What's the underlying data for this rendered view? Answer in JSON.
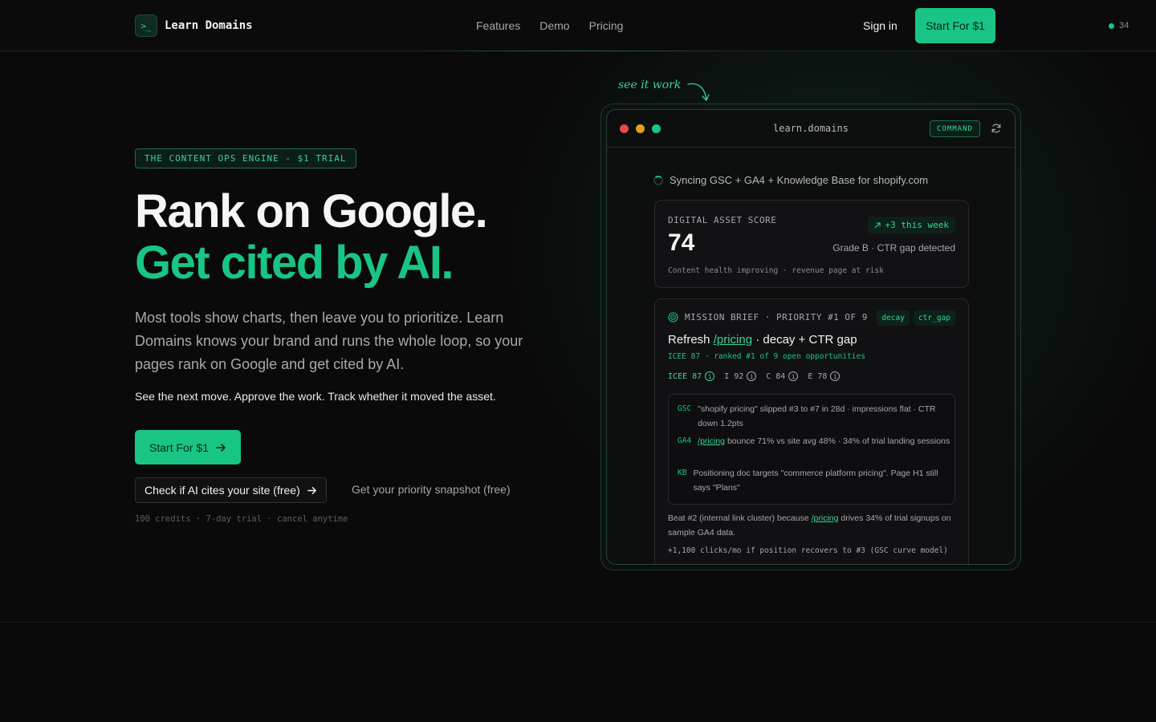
{
  "nav": {
    "logo_glyph": ">_",
    "brand": "Learn Domains",
    "links": [
      "Features",
      "Demo",
      "Pricing"
    ],
    "signin": "Sign in",
    "cta": "Start For $1",
    "online_count": "34",
    "accent": "#19c585"
  },
  "hero": {
    "badge": "THE CONTENT OPS ENGINE - $1 TRIAL",
    "title_line1": "Rank on Google.",
    "title_line2": "Get cited by AI.",
    "lead": "Most tools show charts, then leave you to prioritize. Learn Domains knows your brand and runs the whole loop, so your pages rank on Google and get cited by AI.",
    "sub": "See the next move. Approve the work. Track whether it moved the asset.",
    "cta_main": "Start For $1",
    "cta_secondary": "Check if AI cites your site (free)",
    "cta_link": "Get your priority snapshot (free)",
    "fine_print": "100 credits · 7-day trial · cancel anytime"
  },
  "demo": {
    "annotation": "see it work",
    "url": "learn.domains",
    "mode_badge": "COMMAND",
    "sync_text": "Syncing GSC + GA4 + Knowledge Base for shopify.com",
    "score_card": {
      "label": "DIGITAL ASSET SCORE",
      "score": "74",
      "delta": "+3 this week",
      "grade": "Grade B · CTR gap detected",
      "footer": "Content health improving · revenue page at risk"
    },
    "mission": {
      "header": "MISSION BRIEF · PRIORITY #1 OF 9",
      "tags": [
        "decay",
        "ctr_gap"
      ],
      "title_prefix": "Refresh",
      "title_link": "/pricing",
      "title_suffix": "· decay + CTR gap",
      "subtitle": "ICEE 87 · ranked #1 of 9 open opportunities",
      "scores": [
        {
          "label": "ICEE 87"
        },
        {
          "label": "I 92"
        },
        {
          "label": "C 84"
        },
        {
          "label": "E 78"
        }
      ],
      "evidence": [
        {
          "src": "GSC",
          "text": "\"shopify pricing\" slipped #3 to #7 in 28d · impressions flat · CTR down 1.2pts"
        },
        {
          "src": "GA4",
          "link": "/pricing",
          "text": "bounce 71% vs site avg 48% · 34% of trial landing sessions"
        },
        {
          "src": "KB",
          "text": "Positioning doc targets \"commerce platform pricing\". Page H1 still says \"Plans\""
        }
      ],
      "beat_prefix": "Beat #2 (internal link cluster) because",
      "beat_link": "/pricing",
      "beat_suffix": "drives 34% of trial signups on sample GA4 data.",
      "projection": "+1,100 clicks/mo if position recovers to #3 (GSC curve model)"
    }
  },
  "colors": {
    "traffic_red": "#e5484d",
    "traffic_yellow": "#e0a21b",
    "traffic_green": "#19c585"
  }
}
